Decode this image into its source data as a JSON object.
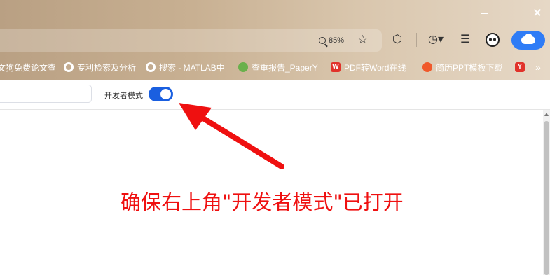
{
  "toolbar": {
    "zoom_level": "85%"
  },
  "bookmarks": [
    {
      "label": "文狗免费论文查",
      "icon": "none"
    },
    {
      "label": "专利检索及分析",
      "icon": "globe-icon"
    },
    {
      "label": "搜索 - MATLAB中",
      "icon": "globe-icon"
    },
    {
      "label": "查重报告_PaperY",
      "icon": "green-logo-icon"
    },
    {
      "label": "PDF转Word在线",
      "icon": "w-logo-icon"
    },
    {
      "label": "简历PPT模板下载",
      "icon": "fox-logo-icon"
    },
    {
      "label": "",
      "icon": "y-logo-icon"
    }
  ],
  "page": {
    "developer_mode_label": "开发者模式",
    "developer_mode_on": true
  },
  "annotation": {
    "text": "确保右上角\"开发者模式\"已打开",
    "color": "#ef1010"
  },
  "colors": {
    "toggle_on": "#1a5fe0",
    "cloud_button": "#2f7cf6"
  }
}
